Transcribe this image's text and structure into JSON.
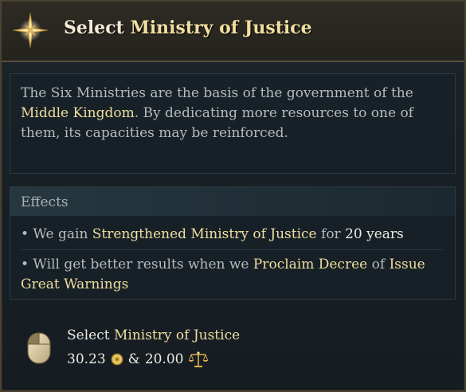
{
  "header": {
    "title_prefix": "Select ",
    "title_highlight": "Ministry of Justice",
    "icon": "compass-star-icon"
  },
  "description": {
    "text_1": "The Six Ministries are the basis of the government of the ",
    "highlight": "Middle Kingdom",
    "text_2": ". By dedicating more resources to one of them, its capacities may be reinforced."
  },
  "effects": {
    "title": "Effects",
    "items": [
      {
        "bullet": "•",
        "text_1": " We gain ",
        "highlight": "Strengthened Ministry of Justice",
        "text_2": " for ",
        "value": "20 years"
      },
      {
        "bullet": "•",
        "text_1": " Will get better results when we ",
        "highlight_1": "Proclaim Decree",
        "text_2": " of ",
        "highlight_2": "Issue Great Warnings"
      }
    ]
  },
  "action": {
    "icon": "mouse-left-click-icon",
    "label_prefix": "Select ",
    "label_highlight": "Ministry of Justice",
    "cost_1": "30.23",
    "cost_1_icon": "gold-coin-icon",
    "separator": "&",
    "cost_2": "20.00",
    "cost_2_icon": "scales-of-justice-icon"
  },
  "colors": {
    "highlight": "#f1dfa0",
    "body_text": "#b7bcbf",
    "border": "#4a4234"
  }
}
